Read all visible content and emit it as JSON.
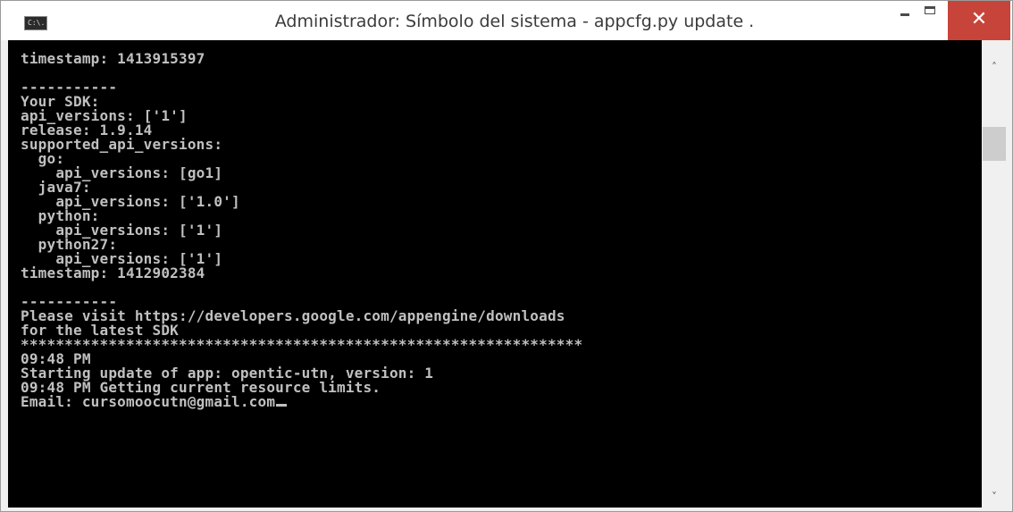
{
  "window": {
    "title": "Administrador: Símbolo del sistema - appcfg.py  update .",
    "icon_label": "C:\\.",
    "controls": {
      "minimize_icon": "minimize-icon",
      "maximize_icon": "maximize-icon",
      "close_glyph": "✕"
    }
  },
  "console": {
    "lines": [
      "timestamp: 1413915397",
      "",
      "-----------",
      "Your SDK:",
      "api_versions: ['1']",
      "release: 1.9.14",
      "supported_api_versions:",
      "  go:",
      "    api_versions: [go1]",
      "  java7:",
      "    api_versions: ['1.0']",
      "  python:",
      "    api_versions: ['1']",
      "  python27:",
      "    api_versions: ['1']",
      "timestamp: 1412902384",
      "",
      "-----------",
      "Please visit https://developers.google.com/appengine/downloads",
      "for the latest SDK",
      "****************************************************************",
      "09:48 PM",
      "Starting update of app: opentic-utn, version: 1",
      "09:48 PM Getting current resource limits.",
      "Email: cursomoocutn@gmail.com"
    ]
  },
  "scrollbar": {
    "up_glyph": "˄",
    "down_glyph": "˅"
  },
  "colors": {
    "console_bg": "#000000",
    "console_fg": "#c0c0c0",
    "close_button": "#c7443a",
    "titlebar": "#ffffff"
  }
}
